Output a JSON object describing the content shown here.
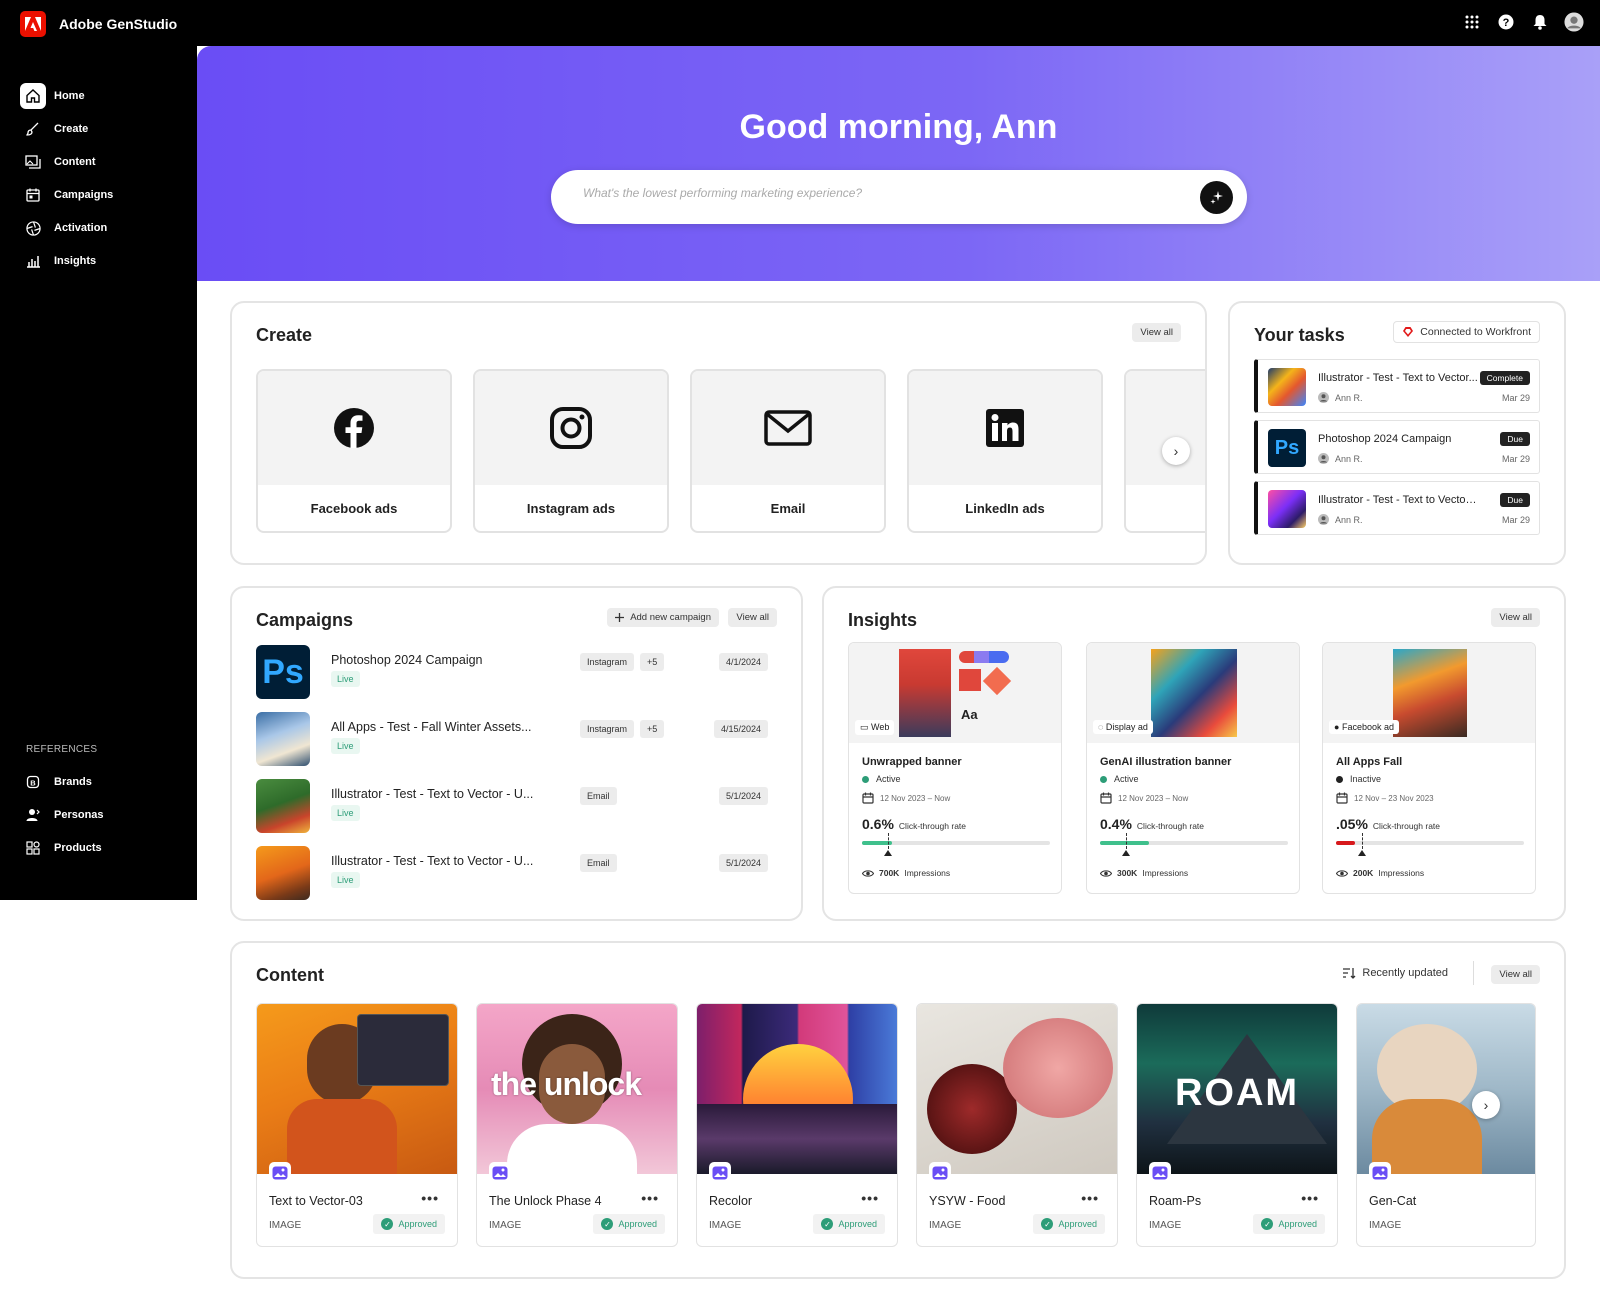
{
  "app": {
    "name": "Adobe GenStudio"
  },
  "nav": {
    "items": [
      {
        "label": "Home",
        "icon": "home-icon"
      },
      {
        "label": "Create",
        "icon": "brush-icon"
      },
      {
        "label": "Content",
        "icon": "images-icon"
      },
      {
        "label": "Campaigns",
        "icon": "calendar-icon"
      },
      {
        "label": "Activation",
        "icon": "aperture-icon"
      },
      {
        "label": "Insights",
        "icon": "chart-icon"
      }
    ],
    "references_heading": "REFERENCES",
    "references": [
      {
        "label": "Brands",
        "icon": "brand-icon"
      },
      {
        "label": "Personas",
        "icon": "persona-icon"
      },
      {
        "label": "Products",
        "icon": "products-icon"
      }
    ]
  },
  "hero": {
    "greeting": "Good morning, Ann",
    "search_placeholder": "What's the lowest performing marketing experience?"
  },
  "create": {
    "title": "Create",
    "view_all": "View all",
    "tiles": [
      {
        "label": "Facebook ads",
        "icon": "facebook-icon"
      },
      {
        "label": "Instagram ads",
        "icon": "instagram-icon"
      },
      {
        "label": "Email",
        "icon": "mail-icon"
      },
      {
        "label": "LinkedIn ads",
        "icon": "linkedin-icon"
      }
    ]
  },
  "tasks": {
    "title": "Your tasks",
    "connected": "Connected to Workfront",
    "items": [
      {
        "name": "Illustrator -  Test - Text to Vector...",
        "user": "Ann R.",
        "date": "Mar 29",
        "badge": "Complete"
      },
      {
        "name": "Photoshop 2024 Campaign",
        "user": "Ann R.",
        "date": "Mar 29",
        "badge": "Due"
      },
      {
        "name": "Illustrator - Test - Text to Vector - US...",
        "user": "Ann R.",
        "date": "Mar 29",
        "badge": "Due"
      }
    ]
  },
  "campaigns": {
    "title": "Campaigns",
    "add_new": "Add new campaign",
    "view_all": "View all",
    "items": [
      {
        "name": "Photoshop 2024 Campaign",
        "status": "Live",
        "channel": "Instagram",
        "extra": "+5",
        "date": "4/1/2024"
      },
      {
        "name": "All Apps - Test - Fall Winter Assets...",
        "status": "Live",
        "channel": "Instagram",
        "extra": "+5",
        "date": "4/15/2024"
      },
      {
        "name": "Illustrator - Test - Text to Vector - U...",
        "status": "Live",
        "channel": "Email",
        "extra": "",
        "date": "5/1/2024"
      },
      {
        "name": "Illustrator - Test - Text to Vector - U...",
        "status": "Live",
        "channel": "Email",
        "extra": "",
        "date": "5/1/2024"
      }
    ]
  },
  "insights": {
    "title": "Insights",
    "view_all": "View all",
    "items": [
      {
        "channel": "Web",
        "name": "Unwrapped banner",
        "status": "Active",
        "status_color": "#2d9d78",
        "dates": "12 Nov 2023 – Now",
        "rate": "0.6%",
        "rate_label": "Click-through rate",
        "fill": 0.16,
        "fill_color": "#3fc08c",
        "marker": 0.14,
        "impressions": "700K",
        "impressions_label": "Impressions"
      },
      {
        "channel": "Display ad",
        "name": "GenAI illustration banner",
        "status": "Active",
        "status_color": "#2d9d78",
        "dates": "12 Nov 2023 – Now",
        "rate": "0.4%",
        "rate_label": "Click-through rate",
        "fill": 0.26,
        "fill_color": "#3fc08c",
        "marker": 0.14,
        "impressions": "300K",
        "impressions_label": "Impressions"
      },
      {
        "channel": "Facebook ad",
        "name": "All Apps Fall",
        "status": "Inactive",
        "status_color": "#222222",
        "dates": "12 Nov – 23 Nov 2023",
        "rate": ".05%",
        "rate_label": "Click-through rate",
        "fill": 0.1,
        "fill_color": "#d7191c",
        "marker": 0.14,
        "impressions": "200K",
        "impressions_label": "Impressions"
      }
    ]
  },
  "content": {
    "title": "Content",
    "sort_label": "Recently updated",
    "view_all": "View all",
    "items": [
      {
        "name": "Text to Vector-03",
        "type": "IMAGE",
        "status": "Approved"
      },
      {
        "name": "The Unlock Phase 4",
        "type": "IMAGE",
        "status": "Approved"
      },
      {
        "name": "Recolor",
        "type": "IMAGE",
        "status": "Approved"
      },
      {
        "name": "YSYW - Food",
        "type": "IMAGE",
        "status": "Approved"
      },
      {
        "name": "Roam-Ps",
        "type": "IMAGE",
        "status": "Approved"
      },
      {
        "name": "Gen-Cat",
        "type": "IMAGE",
        "status": ""
      }
    ],
    "overlay_text_unlock": "the unlock",
    "overlay_text_roam": "ROAM"
  },
  "colors": {
    "accent": "#6a4df5",
    "approved": "#2d9d78",
    "brand_red": "#eb1000"
  }
}
